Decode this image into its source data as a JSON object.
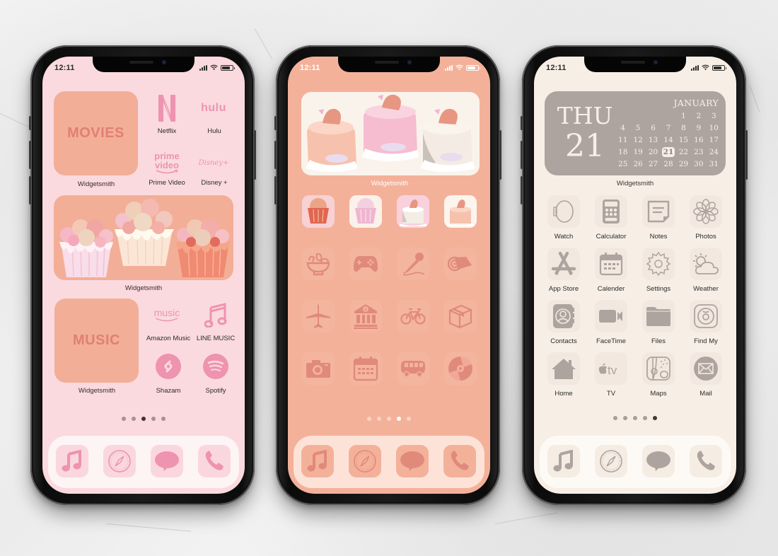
{
  "status_bar": {
    "time": "12:11"
  },
  "phones": [
    {
      "theme": "pink",
      "colors": {
        "bg": "#fadadf",
        "accent": "#f3ae97",
        "icon": "#ee93b0",
        "text": "#e07f76",
        "dock": "#fdf4f5"
      },
      "widgets": [
        {
          "text": "MOVIES",
          "label": "Widgetsmith"
        },
        {
          "text": "",
          "label": "Widgetsmith",
          "image": "cupcakes"
        },
        {
          "text": "MUSIC",
          "label": "Widgetsmith"
        }
      ],
      "apps_top": [
        {
          "name": "Netflix",
          "icon": "netflix-logo",
          "glyph": "N"
        },
        {
          "name": "Hulu",
          "icon": "hulu-logo",
          "glyph": "hulu"
        },
        {
          "name": "Prime Video",
          "icon": "prime-video-logo",
          "glyph": "prime\nvideo"
        },
        {
          "name": "Disney +",
          "icon": "disney-plus-logo",
          "glyph": "Disney+"
        }
      ],
      "apps_bottom": [
        {
          "name": "Amazon Music",
          "icon": "amazon-music-logo",
          "glyph": "music"
        },
        {
          "name": "LINE MUSIC",
          "icon": "music-note-icon",
          "glyph": "♫"
        },
        {
          "name": "Shazam",
          "icon": "shazam-icon",
          "glyph": "S"
        },
        {
          "name": "Spotify",
          "icon": "spotify-icon",
          "glyph": ""
        }
      ],
      "page_dots": {
        "count": 5,
        "active": 2
      },
      "dock": [
        "music",
        "safari",
        "messages",
        "phone"
      ]
    },
    {
      "theme": "peach",
      "colors": {
        "bg": "#f4b19a",
        "icon": "#e08a7c",
        "dock": "#fde3d7"
      },
      "widget": {
        "label": "Widgetsmith",
        "image": "strawberry-cakes"
      },
      "thumbnails": [
        "cupcake-orange",
        "cupcake-pink",
        "cake-white",
        "cake-peach"
      ],
      "icon_grid": [
        "salad-bowl",
        "game-controller",
        "microphone",
        "yoga-mat",
        "airplane",
        "bank",
        "bicycle",
        "package-box",
        "camera",
        "calendar",
        "bus",
        "disc"
      ],
      "page_dots": {
        "count": 5,
        "active": 3
      },
      "dock": [
        "music",
        "safari",
        "messages",
        "phone"
      ]
    },
    {
      "theme": "beige",
      "colors": {
        "bg": "#f7efe6",
        "icon": "#aea49f",
        "widget": "#aea49f",
        "dock": "#fdfaf6"
      },
      "calendar": {
        "day": "THU",
        "date": "21",
        "month": "JANUARY",
        "leading_blanks": 4,
        "days_in_month": 31,
        "today": 21,
        "label": "Widgetsmith"
      },
      "apps": [
        {
          "name": "Watch",
          "icon": "watch"
        },
        {
          "name": "Calculator",
          "icon": "calculator"
        },
        {
          "name": "Notes",
          "icon": "notes"
        },
        {
          "name": "Photos",
          "icon": "photos"
        },
        {
          "name": "App Store",
          "icon": "app-store"
        },
        {
          "name": "Calender",
          "icon": "calendar"
        },
        {
          "name": "Settings",
          "icon": "gear"
        },
        {
          "name": "Weather",
          "icon": "weather"
        },
        {
          "name": "Contacts",
          "icon": "contacts"
        },
        {
          "name": "FaceTime",
          "icon": "facetime"
        },
        {
          "name": "Files",
          "icon": "folder"
        },
        {
          "name": "Find My",
          "icon": "find-my"
        },
        {
          "name": "Home",
          "icon": "home"
        },
        {
          "name": "TV",
          "icon": "apple-tv"
        },
        {
          "name": "Maps",
          "icon": "maps"
        },
        {
          "name": "Mail",
          "icon": "mail"
        }
      ],
      "page_dots": {
        "count": 5,
        "active": 4
      },
      "dock": [
        "music",
        "safari",
        "messages",
        "phone"
      ]
    }
  ]
}
